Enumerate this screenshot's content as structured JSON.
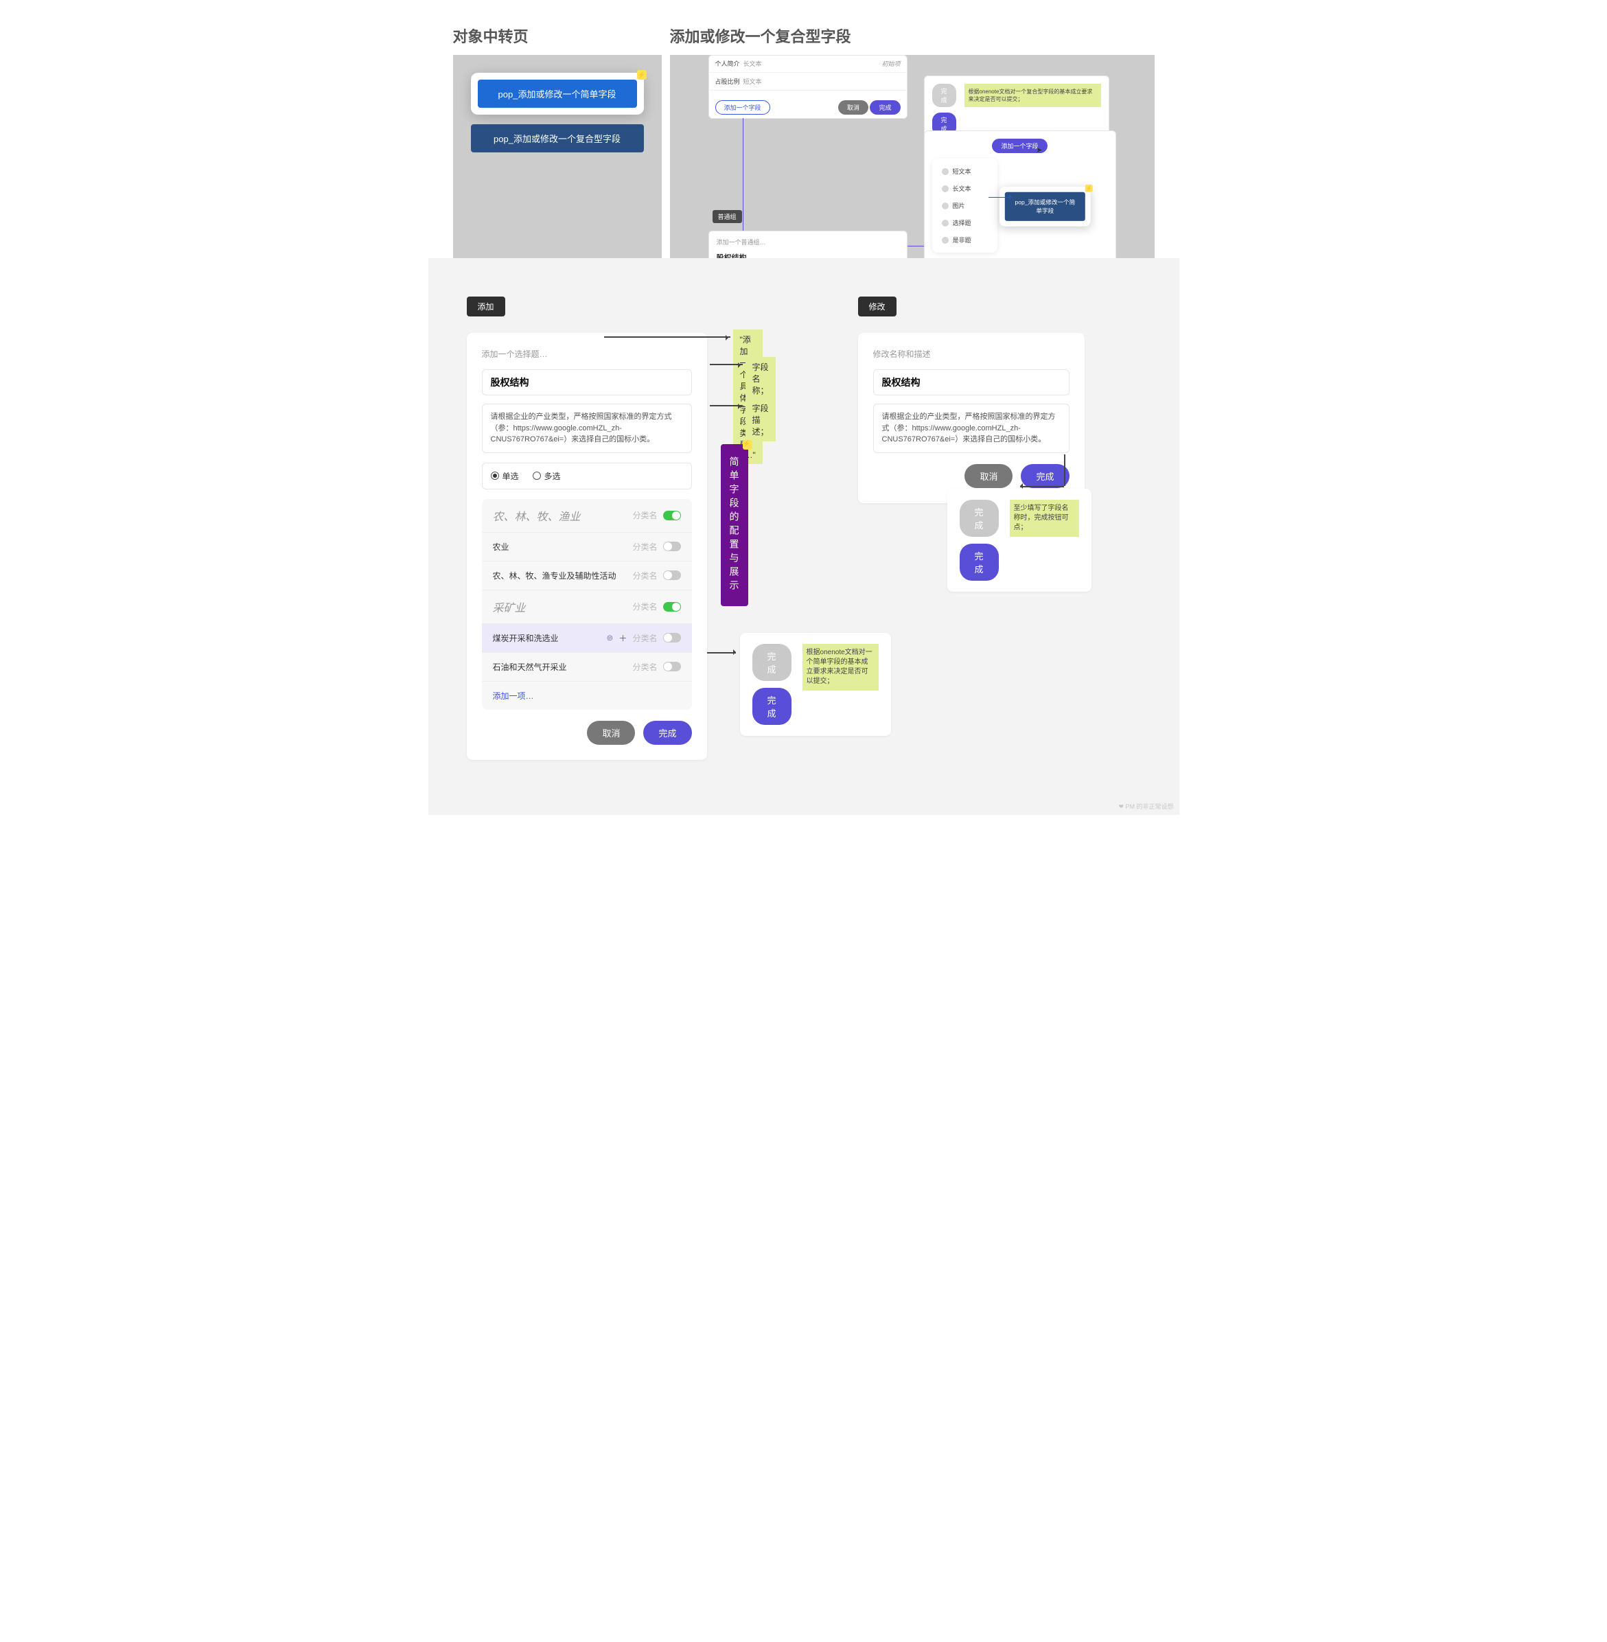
{
  "sections": {
    "left_title": "对象中转页",
    "right_title": "添加或修改一个复合型字段"
  },
  "left_panel": {
    "btn1": "pop_添加或修改一个简单字段",
    "btn2": "pop_添加或修改一个复合型字段"
  },
  "right_panel": {
    "form_rows": [
      {
        "label": "个人简介",
        "type": "长文本",
        "badge": "初始项"
      },
      {
        "label": "占股比例",
        "type": "短文本",
        "badge": ""
      }
    ],
    "add_link": "添加一个字段",
    "cancel": "取消",
    "done": "完成",
    "state_disabled": "完成",
    "state_enabled": "完成",
    "note": "根据onenote文档对一个复合型字段的基本成立要求来决定是否可以提交；",
    "tag_group": "普通组",
    "group_title": "添加一个普通组…",
    "group_input": "股权结构",
    "menu_title": "添加一个字段",
    "menu_items": [
      "短文本",
      "长文本",
      "图片",
      "选择题",
      "是非题"
    ],
    "pop_btn": "pop_添加或修改一个简单字段"
  },
  "big": {
    "chip_add": "添加",
    "chip_mod": "修改",
    "addForm": {
      "header": "添加一个选择题…",
      "name": "股权结构",
      "desc": "请根据企业的产业类型，严格按照国家标准的界定方式（参：https://www.google.comHZL_zh-CNUS767RO767&ei=）来选择自己的国标小类。",
      "radio_single": "单选",
      "radio_multi": "多选",
      "cats": [
        {
          "label": "农、林、牧、渔业",
          "kind": "cat",
          "on": true
        },
        {
          "label": "农业",
          "kind": "item",
          "on": false
        },
        {
          "label": "农、林、牧、渔专业及辅助性活动",
          "kind": "item",
          "on": false
        },
        {
          "label": "采矿业",
          "kind": "cat",
          "on": true
        },
        {
          "label": "煤炭开采和洗选业",
          "kind": "item",
          "on": false,
          "hl": true
        },
        {
          "label": "石油和天然气开采业",
          "kind": "item",
          "on": false
        }
      ],
      "add_item": "添加一项…",
      "tag_label": "分类名",
      "cancel": "取消",
      "done": "完成"
    },
    "annotations": {
      "a1": "\"添加一个<具体字段类型>…\"",
      "a2": "字段名称；",
      "a3": "字段描述；",
      "vbar": "简单字段的配置与展示"
    },
    "flow_note_left": "根据onenote文档对一个简单字段的基本成立要求来决定是否可以提交；",
    "modForm": {
      "header": "修改名称和描述",
      "name": "股权结构",
      "desc": "请根据企业的产业类型，严格按照国家标准的界定方式（参：https://www.google.comHZL_zh-CNUS767RO767&ei=）来选择自己的国标小类。",
      "cancel": "取消",
      "done": "完成"
    },
    "flow_note_right": "至少填写了字段名称时，完成按钮可点；",
    "state_disabled": "完成",
    "state_enabled": "完成"
  },
  "footer": "PM 的非正常设想"
}
